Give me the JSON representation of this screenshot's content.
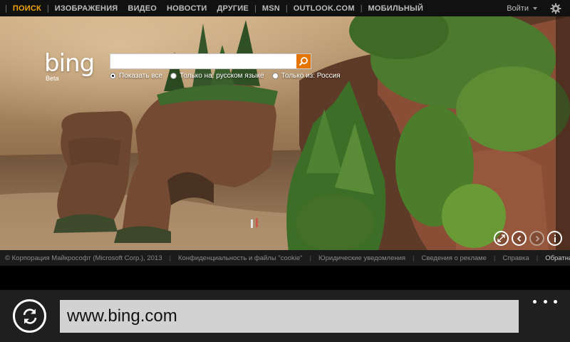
{
  "nav": {
    "items": [
      {
        "label": "ПОИСК",
        "active": true
      },
      {
        "label": "ИЗОБРАЖЕНИЯ"
      },
      {
        "label": "ВИДЕО"
      },
      {
        "label": "НОВОСТИ"
      },
      {
        "label": "ДРУГИЕ"
      },
      {
        "label": "MSN"
      },
      {
        "label": "OUTLOOK.COM"
      },
      {
        "label": "МОБИЛЬНЫЙ"
      }
    ],
    "signin_label": "Войти",
    "settings_icon": "gear-icon",
    "active_color": "#f0a30a"
  },
  "brand": {
    "logo": "bing",
    "sub": "Beta"
  },
  "search": {
    "value": "",
    "button_icon": "search-icon",
    "button_color": "#e37500",
    "scopes": [
      {
        "label": "Показать все",
        "selected": true
      },
      {
        "label": "Только на: русском языке",
        "selected": false
      },
      {
        "label": "Только из: Россия",
        "selected": false
      }
    ]
  },
  "hero_controls": [
    {
      "icon": "expand-icon"
    },
    {
      "icon": "chevron-left-icon"
    },
    {
      "icon": "chevron-right-icon"
    },
    {
      "icon": "info-icon"
    }
  ],
  "footer": {
    "copyright": "© Корпорация Майкрософт (Microsoft Corp.), 2013",
    "links": [
      "Конфиденциальность и файлы \"cookie\"",
      "Юридические уведомления",
      "Сведения о рекламе",
      "Справка",
      "Обратная связь"
    ]
  },
  "browser": {
    "address": "www.bing.com",
    "refresh_icon": "refresh-icon",
    "more_icon": "more-icon"
  }
}
